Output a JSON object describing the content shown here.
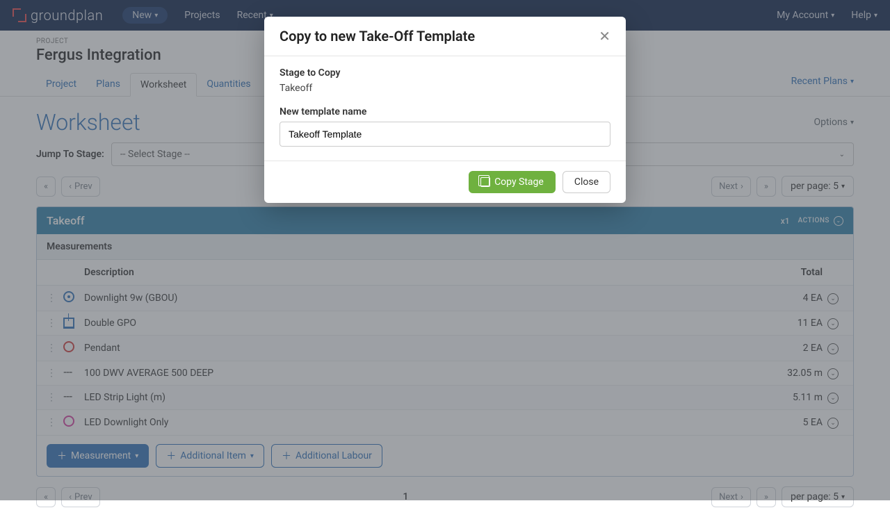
{
  "brand": "groundplan",
  "nav": {
    "new": "New",
    "projects": "Projects",
    "recent": "Recent",
    "my_account": "My Account",
    "help": "Help"
  },
  "project": {
    "label": "PROJECT",
    "name": "Fergus Integration"
  },
  "tabs": {
    "project": "Project",
    "plans": "Plans",
    "worksheet": "Worksheet",
    "quantities": "Quantities",
    "recent_plans": "Recent Plans"
  },
  "page": {
    "title": "Worksheet",
    "options": "Options"
  },
  "jump": {
    "label": "Jump To Stage:",
    "placeholder": "-- Select Stage --"
  },
  "pager": {
    "prev": "Prev",
    "next": "Next",
    "page": "1",
    "per_page": "per page: 5"
  },
  "stage": {
    "name": "Takeoff",
    "multiplier": "x1",
    "actions": "ACTIONS",
    "measurements_label": "Measurements",
    "col_description": "Description",
    "col_total": "Total",
    "rows": [
      {
        "icon": "circle-blue",
        "desc": "Downlight 9w (GBOU)",
        "total": "4 EA"
      },
      {
        "icon": "grid-blue",
        "desc": "Double GPO",
        "total": "11 EA"
      },
      {
        "icon": "circle-red",
        "desc": "Pendant",
        "total": "2 EA"
      },
      {
        "icon": "dashes",
        "desc": "100 DWV AVERAGE 500 DEEP",
        "total": "32.05 m"
      },
      {
        "icon": "dashes",
        "desc": "LED Strip Light (m)",
        "total": "5.11 m"
      },
      {
        "icon": "circle-pink",
        "desc": "LED Downlight Only",
        "total": "5 EA"
      }
    ],
    "add_measurement": "Measurement",
    "add_additional_item": "Additional Item",
    "add_additional_labour": "Additional Labour"
  },
  "modal": {
    "title": "Copy to new Take-Off Template",
    "stage_label": "Stage to Copy",
    "stage_value": "Takeoff",
    "name_label": "New template name",
    "name_value": "Takeoff Template",
    "copy_btn": "Copy Stage",
    "close_btn": "Close"
  }
}
